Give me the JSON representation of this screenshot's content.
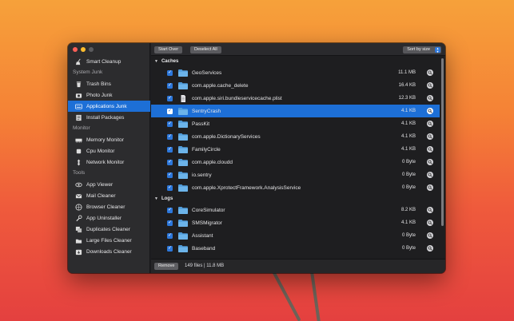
{
  "sidebar": {
    "top_item": {
      "label": "Smart Cleanup",
      "icon": "broom-icon"
    },
    "sections": [
      {
        "title": "System Junk",
        "items": [
          {
            "label": "Trash Bins",
            "icon": "trash-icon"
          },
          {
            "label": "Photo Junk",
            "icon": "camera-icon"
          },
          {
            "label": "Applications Junk",
            "icon": "keyboard-icon",
            "active": true
          },
          {
            "label": "Install Packages",
            "icon": "package-icon"
          }
        ]
      },
      {
        "title": "Monitor",
        "items": [
          {
            "label": "Memory Monitor",
            "icon": "memory-icon"
          },
          {
            "label": "Cpu Monitor",
            "icon": "cpu-icon"
          },
          {
            "label": "Network Monitor",
            "icon": "network-icon"
          }
        ]
      },
      {
        "title": "Tools",
        "items": [
          {
            "label": "App Viewer",
            "icon": "eye-icon"
          },
          {
            "label": "Mail Cleaner",
            "icon": "mail-icon"
          },
          {
            "label": "Browser Cleaner",
            "icon": "browser-icon"
          },
          {
            "label": "App Uninstaller",
            "icon": "wrench-icon"
          },
          {
            "label": "Duplicates Cleaner",
            "icon": "duplicate-icon"
          },
          {
            "label": "Large Files Cleaner",
            "icon": "files-icon"
          },
          {
            "label": "Downloads Cleaner",
            "icon": "download-icon"
          }
        ]
      }
    ]
  },
  "toolbar": {
    "start_over": "Start Over",
    "deselect_all": "Deselect All",
    "sort": "Sort by size"
  },
  "groups": [
    {
      "title": "Caches",
      "rows": [
        {
          "name": "GeoServices",
          "size": "11.1 MB",
          "icon": "folder"
        },
        {
          "name": "com.apple.cache_delete",
          "size": "16.4 KB",
          "icon": "folder"
        },
        {
          "name": "com.apple.siri.bundleservicecache.plist",
          "size": "12.3 KB",
          "icon": "document"
        },
        {
          "name": "SentryCrash",
          "size": "4.1 KB",
          "icon": "folder",
          "selected": true
        },
        {
          "name": "PassKit",
          "size": "4.1 KB",
          "icon": "folder"
        },
        {
          "name": "com.apple.DictionaryServices",
          "size": "4.1 KB",
          "icon": "folder"
        },
        {
          "name": "FamilyCircle",
          "size": "4.1 KB",
          "icon": "folder"
        },
        {
          "name": "com.apple.cloudd",
          "size": "0 Byte",
          "icon": "folder"
        },
        {
          "name": "io.sentry",
          "size": "0 Byte",
          "icon": "folder"
        },
        {
          "name": "com.apple.XprotectFramework.AnalysisService",
          "size": "0 Byte",
          "icon": "folder"
        }
      ]
    },
    {
      "title": "Logs",
      "rows": [
        {
          "name": "CoreSimulator",
          "size": "8.2 KB",
          "icon": "folder"
        },
        {
          "name": "SMSMigrator",
          "size": "4.1 KB",
          "icon": "folder"
        },
        {
          "name": "Assistant",
          "size": "0 Byte",
          "icon": "folder"
        },
        {
          "name": "Baseband",
          "size": "0 Byte",
          "icon": "folder"
        }
      ]
    }
  ],
  "footer": {
    "remove": "Remove",
    "summary": "149 files | 11.8 MB"
  },
  "colors": {
    "accent": "#1d6fd6",
    "checkbox": "#2c77db",
    "folder": "#5aa6e0"
  }
}
